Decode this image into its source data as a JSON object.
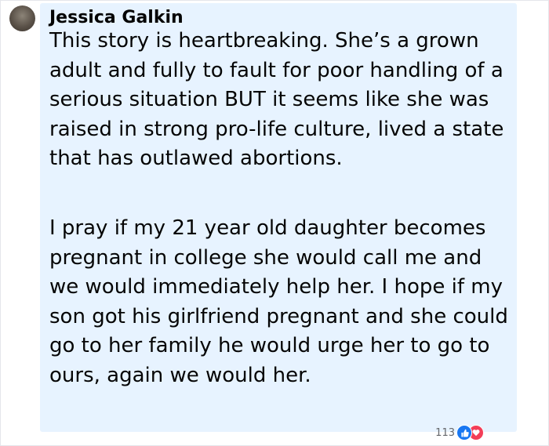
{
  "comment": {
    "author": "Jessica Galkin",
    "paragraphs": [
      "This story is heartbreaking. She’s a grown adult and fully to fault for poor handling of a serious situation BUT it seems like she was raised in strong pro-life culture, lived a state that has outlawed abortions.",
      "I pray if my 21 year old daughter becomes pregnant in college she would call me and we would immediately help her. I hope if my son got his girlfriend pregnant and she could go to her family he would urge her to go to ours, again we would her."
    ],
    "reaction_count": "113",
    "reactions": [
      "like-icon",
      "love-icon"
    ]
  },
  "colors": {
    "bubble": "#e7f3ff",
    "like": "#1877f2",
    "love": "#f33e58"
  }
}
